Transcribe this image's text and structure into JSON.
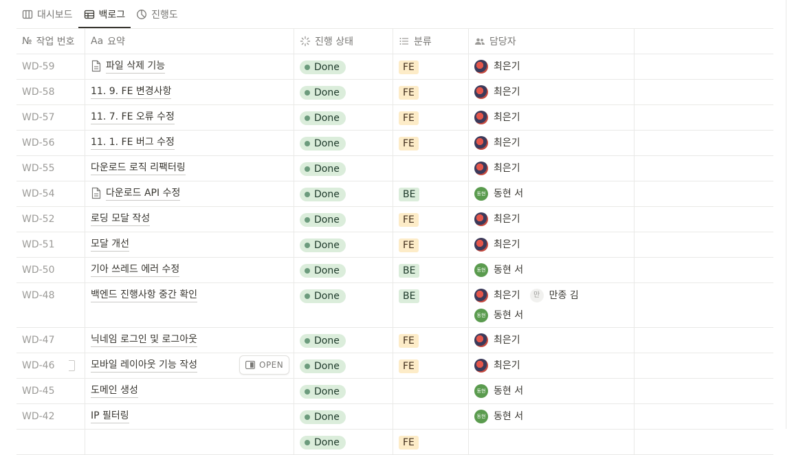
{
  "tabs": [
    {
      "label": "대시보드",
      "icon": "columns-icon"
    },
    {
      "label": "백로그",
      "icon": "table-icon",
      "active": true
    },
    {
      "label": "진행도",
      "icon": "pie-icon"
    }
  ],
  "columns": {
    "id": "작업 번호",
    "summary": "요약",
    "status": "진행 상태",
    "category": "분류",
    "owner": "담당자"
  },
  "header_icons": {
    "id": "№",
    "summary": "Aa"
  },
  "rows": [
    {
      "id": "WD-59",
      "summary": "파일 삭제 기능",
      "page_icon": true,
      "status": "Done",
      "category": "FE",
      "owners": [
        "최은기"
      ]
    },
    {
      "id": "WD-58",
      "summary": "11. 9. FE 변경사항",
      "status": "Done",
      "category": "FE",
      "owners": [
        "최은기"
      ]
    },
    {
      "id": "WD-57",
      "summary": "11. 7. FE 오류 수정",
      "status": "Done",
      "category": "FE",
      "owners": [
        "최은기"
      ]
    },
    {
      "id": "WD-56",
      "summary": "11. 1. FE 버그 수정",
      "status": "Done",
      "category": "FE",
      "owners": [
        "최은기"
      ]
    },
    {
      "id": "WD-55",
      "summary": "다운로드 로직 리팩터링",
      "status": "Done",
      "category": "",
      "owners": [
        "최은기"
      ]
    },
    {
      "id": "WD-54",
      "summary": "다운로드 API 수정",
      "page_icon": true,
      "status": "Done",
      "category": "BE",
      "owners": [
        "동현 서"
      ]
    },
    {
      "id": "WD-52",
      "summary": "로딩 모달 작성",
      "status": "Done",
      "category": "FE",
      "owners": [
        "최은기"
      ]
    },
    {
      "id": "WD-51",
      "summary": "모달 개선",
      "status": "Done",
      "category": "FE",
      "owners": [
        "최은기"
      ]
    },
    {
      "id": "WD-50",
      "summary": "기아 쓰레드 에러 수정",
      "status": "Done",
      "category": "BE",
      "owners": [
        "동현 서"
      ]
    },
    {
      "id": "WD-48",
      "summary": "백엔드 진행사항 중간 확인",
      "status": "Done",
      "category": "BE",
      "owners": [
        "최은기",
        "만종 김",
        "동현 서"
      ]
    },
    {
      "id": "WD-47",
      "summary": "닉네임 로그인 및 로그아웃",
      "status": "Done",
      "category": "FE",
      "owners": [
        "최은기"
      ]
    },
    {
      "id": "WD-46",
      "summary": "모바일 레이아웃 기능 작성",
      "status": "Done",
      "category": "FE",
      "owners": [
        "최은기"
      ],
      "hover": true
    },
    {
      "id": "WD-45",
      "summary": "도메인 생성",
      "status": "Done",
      "category": "",
      "owners": [
        "동현 서"
      ]
    },
    {
      "id": "WD-42",
      "summary": "IP 필터링",
      "status": "Done",
      "category": "",
      "owners": [
        "동현 서"
      ]
    },
    {
      "id": "",
      "summary": "",
      "status": "Done",
      "category": "FE",
      "owners": []
    }
  ],
  "open_button_label": "OPEN",
  "avatar_text": {
    "동현 서": "동현",
    "만종 김": "만"
  },
  "colors": {
    "done_bg": "#dbeddb",
    "done_dot": "#6c9b7d",
    "fe_bg": "#fdecc8",
    "fe_text": "#402c1b",
    "be_bg": "#dbeddb",
    "be_text": "#1c3829"
  }
}
